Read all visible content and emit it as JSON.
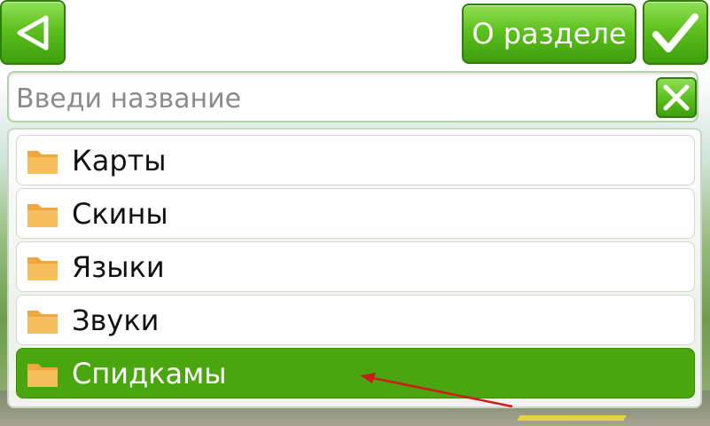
{
  "header": {
    "about_label": "О разделе"
  },
  "search": {
    "placeholder": "Введи название"
  },
  "list": {
    "items": [
      {
        "label": "Карты"
      },
      {
        "label": "Скины"
      },
      {
        "label": "Языки"
      },
      {
        "label": "Звуки"
      },
      {
        "label": "Спидкамы"
      }
    ],
    "selected_index": 4
  },
  "icons": {
    "back": "back-triangle-icon",
    "ok": "checkmark-icon",
    "clear": "close-icon",
    "folder": "folder-icon"
  },
  "colors": {
    "accent_green": "#4aa60e",
    "annotation_arrow": "#d11a1a"
  }
}
